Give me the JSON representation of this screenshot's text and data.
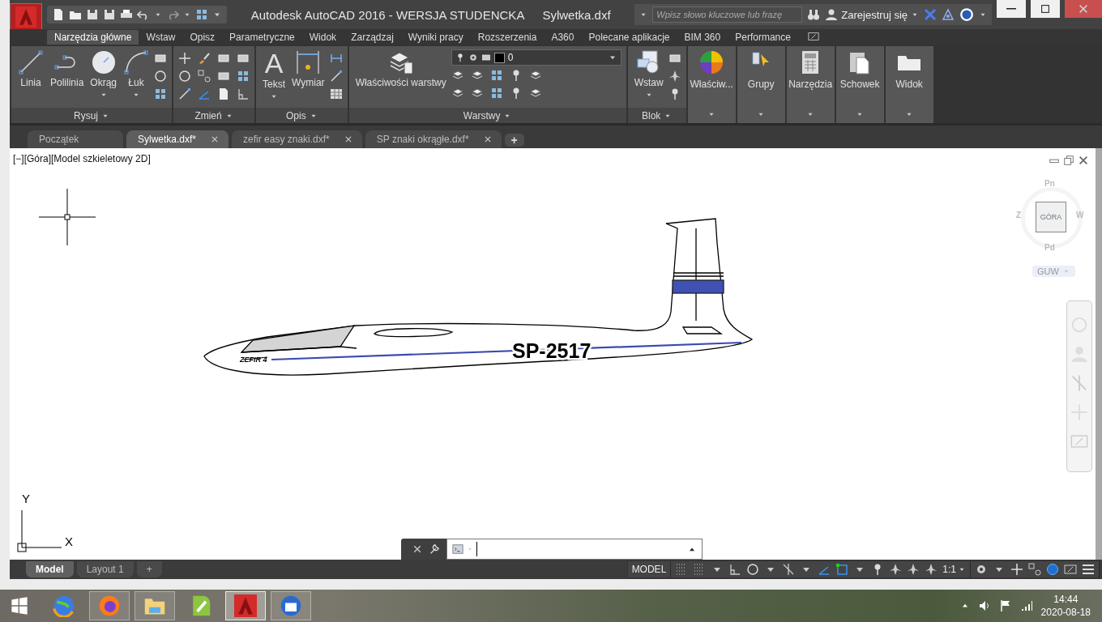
{
  "title_bar": {
    "title": "Autodesk AutoCAD 2016 - WERSJA STUDENCKA",
    "file": "Sylwetka.dxf",
    "search": {
      "placeholder": "Wpisz słowo kluczowe lub frazę"
    },
    "sign_in": "Zarejestruj się"
  },
  "ribbon": {
    "tabs": [
      {
        "label": "Narzędzia główne",
        "selected": true
      },
      {
        "label": "Wstaw",
        "selected": false
      },
      {
        "label": "Opisz",
        "selected": false
      },
      {
        "label": "Parametryczne",
        "selected": false
      },
      {
        "label": "Widok",
        "selected": false
      },
      {
        "label": "Zarządzaj",
        "selected": false
      },
      {
        "label": "Wyniki pracy",
        "selected": false
      },
      {
        "label": "Rozszerzenia",
        "selected": false
      },
      {
        "label": "A360",
        "selected": false
      },
      {
        "label": "Polecane aplikacje",
        "selected": false
      },
      {
        "label": "BIM 360",
        "selected": false
      },
      {
        "label": "Performance",
        "selected": false
      }
    ],
    "panels": [
      {
        "title": "Rysuj",
        "tools": [
          {
            "label": "Linia",
            "dropdown": false
          },
          {
            "label": "Polilinia",
            "dropdown": false
          },
          {
            "label": "Okrąg",
            "dropdown": true
          },
          {
            "label": "Łuk",
            "dropdown": true
          }
        ]
      },
      {
        "title": "Zmień"
      },
      {
        "title": "Opis",
        "tools": [
          {
            "label": "Tekst",
            "glyph": "A",
            "dropdown": true
          },
          {
            "label": "Wymiar",
            "dropdown": false
          }
        ]
      },
      {
        "title": "Warstwy",
        "tools": [
          {
            "label": "Właściwości warstwy",
            "dropdown": false
          }
        ],
        "layer": "0"
      },
      {
        "title": "Blok",
        "tools": [
          {
            "label": "Wstaw",
            "dropdown": true
          }
        ]
      }
    ],
    "collapsed_panels": [
      {
        "label": "Właściw..."
      },
      {
        "label": "Grupy"
      },
      {
        "label": "Narzędzia"
      },
      {
        "label": "Schowek"
      },
      {
        "label": "Widok"
      }
    ]
  },
  "doc_tabs": [
    {
      "label": "Początek",
      "selected": false,
      "closable": false
    },
    {
      "label": "Sylwetka.dxf*",
      "selected": true,
      "closable": true
    },
    {
      "label": "zefir easy znaki.dxf*",
      "selected": false,
      "closable": true
    },
    {
      "label": "SP znaki okrągłe.dxf*",
      "selected": false,
      "closable": true
    }
  ],
  "new_tab": "+",
  "viewport": {
    "label": "[−][Góra][Model szkieletowy 2D]",
    "viewcube": {
      "face": "GÓRA",
      "north": "Pn",
      "west": "Z",
      "east": "W",
      "south": "Pd",
      "ucs": "GUW"
    },
    "axes": {
      "y": "Y",
      "x": "X"
    },
    "drawing": {
      "registration": "SP-2517",
      "logo": "ZEFIR 4"
    }
  },
  "layout_tabs": [
    {
      "label": "Model",
      "selected": true
    },
    {
      "label": "Layout 1",
      "selected": false
    }
  ],
  "new_layout": "+",
  "status_bar": {
    "mode": "MODEL",
    "scale": "1:1"
  },
  "taskbar": {
    "apps": [
      {
        "running": false,
        "selected": false
      },
      {
        "running": true,
        "selected": false
      },
      {
        "running": true,
        "selected": false
      },
      {
        "running": false,
        "selected": false
      },
      {
        "running": true,
        "selected": true
      },
      {
        "running": true,
        "selected": false
      }
    ],
    "time": "14:44",
    "date": "2020-08-18"
  }
}
